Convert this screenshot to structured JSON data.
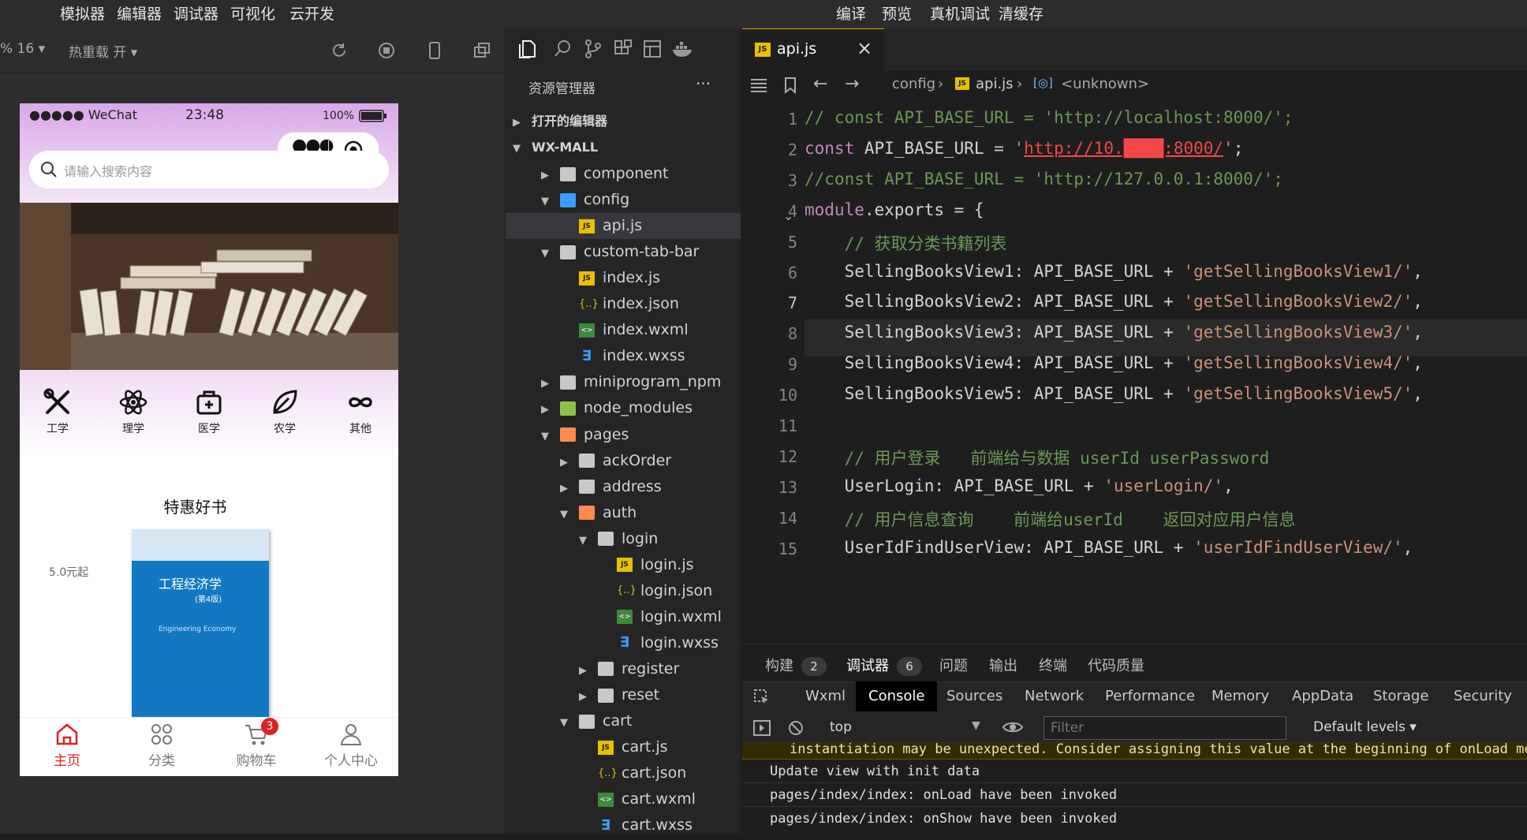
{
  "menu": {
    "left_items": [
      "模拟器",
      "编辑器",
      "调试器",
      "可视化",
      "云开发"
    ],
    "right_items": [
      "编译",
      "预览",
      "真机调试",
      "清缓存"
    ]
  },
  "simulator_toolbar": {
    "zoom": "% 16",
    "hot_reload": "热重载 开"
  },
  "phone": {
    "status": {
      "carrier": "●●●●● WeChat",
      "time": "23:48",
      "battery": "100%"
    },
    "search_placeholder": "请输入搜索内容",
    "categories": [
      "工学",
      "理学",
      "医学",
      "农学",
      "其他"
    ],
    "section_title": "特惠好书",
    "price_label": "5.0元起",
    "book": {
      "title": "工程经济学",
      "edition": "(第4版)",
      "subtitle_en": "Engineering Economy"
    },
    "tabbar": [
      {
        "label": "主页",
        "active": true
      },
      {
        "label": "分类",
        "active": false
      },
      {
        "label": "购物车",
        "active": false,
        "badge": "3"
      },
      {
        "label": "个人中心",
        "active": false
      }
    ]
  },
  "explorer": {
    "title": "资源管理器",
    "more": "···",
    "sections": [
      "打开的编辑器",
      "WX-MALL"
    ],
    "tree": [
      {
        "label": "component",
        "type": "folder",
        "open": false
      },
      {
        "label": "config",
        "type": "folder",
        "open": true
      },
      {
        "label": "api.js",
        "type": "js",
        "selected": true
      },
      {
        "label": "custom-tab-bar",
        "type": "folder",
        "open": true
      },
      {
        "label": "index.js",
        "type": "js"
      },
      {
        "label": "index.json",
        "type": "json"
      },
      {
        "label": "index.wxml",
        "type": "wxml"
      },
      {
        "label": "index.wxss",
        "type": "wxss"
      },
      {
        "label": "miniprogram_npm",
        "type": "folder",
        "open": false
      },
      {
        "label": "node_modules",
        "type": "folder",
        "open": false
      },
      {
        "label": "pages",
        "type": "folder",
        "open": true
      },
      {
        "label": "ackOrder",
        "type": "folder",
        "open": false
      },
      {
        "label": "address",
        "type": "folder",
        "open": false
      },
      {
        "label": "auth",
        "type": "folder",
        "open": true
      },
      {
        "label": "login",
        "type": "folder",
        "open": true
      },
      {
        "label": "login.js",
        "type": "js"
      },
      {
        "label": "login.json",
        "type": "json"
      },
      {
        "label": "login.wxml",
        "type": "wxml"
      },
      {
        "label": "login.wxss",
        "type": "wxss"
      },
      {
        "label": "register",
        "type": "folder",
        "open": false
      },
      {
        "label": "reset",
        "type": "folder",
        "open": false
      },
      {
        "label": "cart",
        "type": "folder",
        "open": true
      },
      {
        "label": "cart.js",
        "type": "js"
      },
      {
        "label": "cart.json",
        "type": "json"
      },
      {
        "label": "cart.wxml",
        "type": "wxml"
      },
      {
        "label": "cart.wxss",
        "type": "wxss"
      }
    ]
  },
  "editor": {
    "tab": "api.js",
    "breadcrumb": [
      "config",
      "api.js",
      "<unknown>"
    ],
    "active_line": 7,
    "lines": [
      {
        "n": "1",
        "text": "// const API_BASE_URL = 'http://localhost:8000/';"
      },
      {
        "n": "2",
        "text": "const API_BASE_URL = 'http://10.████:8000/';"
      },
      {
        "n": "3",
        "text": "//const API_BASE_URL = 'http://127.0.0.1:8000/';"
      },
      {
        "n": "4",
        "text": "module.exports = {"
      },
      {
        "n": "5",
        "text": "  // 获取分类书籍列表"
      },
      {
        "n": "6",
        "text": "  SellingBooksView1: API_BASE_URL + 'getSellingBooksView1/',"
      },
      {
        "n": "7",
        "text": "  SellingBooksView2: API_BASE_URL + 'getSellingBooksView2/',"
      },
      {
        "n": "8",
        "text": "  SellingBooksView3: API_BASE_URL + 'getSellingBooksView3/',"
      },
      {
        "n": "9",
        "text": "  SellingBooksView4: API_BASE_URL + 'getSellingBooksView4/',"
      },
      {
        "n": "10",
        "text": "  SellingBooksView5: API_BASE_URL + 'getSellingBooksView5/',"
      },
      {
        "n": "11",
        "text": ""
      },
      {
        "n": "12",
        "text": "  // 用户登录   前端给与数据 userId userPassword"
      },
      {
        "n": "13",
        "text": "  UserLogin: API_BASE_URL + 'userLogin/',"
      },
      {
        "n": "14",
        "text": "  // 用户信息查询    前端给userId    返回对应用户信息"
      },
      {
        "n": "15",
        "text": "  UserIdFindUserView: API_BASE_URL + 'userIdFindUserView/',"
      }
    ]
  },
  "panel": {
    "tabs": [
      {
        "label": "构建",
        "badge": "2"
      },
      {
        "label": "调试器",
        "badge": "6",
        "active": true
      },
      {
        "label": "问题"
      },
      {
        "label": "输出"
      },
      {
        "label": "终端"
      },
      {
        "label": "代码质量"
      }
    ],
    "devtools_tabs": [
      "Wxml",
      "Console",
      "Sources",
      "Network",
      "Performance",
      "Memory",
      "AppData",
      "Storage",
      "Security"
    ],
    "active_devtools_tab": "Console",
    "context": "top",
    "filter_placeholder": "Filter",
    "levels": "Default levels",
    "logs": [
      "instantiation may be unexpected. Consider assigning this value at the beginning of onLoad method",
      "Update view with init data",
      "pages/index/index: onLoad have been invoked",
      "pages/index/index: onShow have been invoked"
    ]
  },
  "colors": {
    "accent_red": "#e02020",
    "selection": "#37373d",
    "comment": "#6a9955",
    "string": "#ce9178"
  }
}
